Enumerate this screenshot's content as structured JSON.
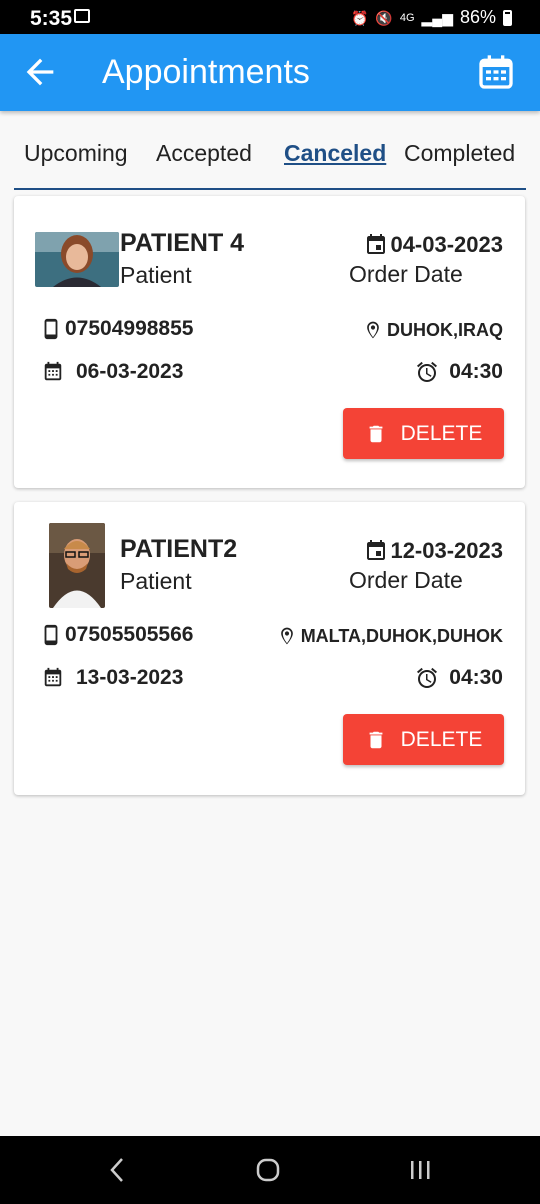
{
  "status_bar": {
    "time": "5:35",
    "signal": "4G",
    "battery": "86%"
  },
  "app_bar": {
    "title": "Appointments"
  },
  "tabs": [
    {
      "label": "Upcoming",
      "active": false
    },
    {
      "label": "Accepted",
      "active": false
    },
    {
      "label": "Canceled",
      "active": true
    },
    {
      "label": "Completed",
      "active": false
    }
  ],
  "appointments": [
    {
      "name": "PATIENT 4",
      "role": "Patient",
      "order_date": "04-03-2023",
      "order_label": "Order Date",
      "phone": "07504998855",
      "location": "DUHOK,IRAQ",
      "date": "06-03-2023",
      "time": "04:30",
      "delete_label": "DELETE"
    },
    {
      "name": "PATIENT2",
      "role": "Patient",
      "order_date": "12-03-2023",
      "order_label": "Order Date",
      "phone": "07505505566",
      "location": "MALTA,DUHOK,DUHOK",
      "date": "13-03-2023",
      "time": "04:30",
      "delete_label": "DELETE"
    }
  ],
  "colors": {
    "primary": "#2196f3",
    "tab_active": "#1f4f86",
    "delete": "#f44336"
  },
  "icons": [
    "back-arrow-icon",
    "calendar-icon",
    "event-icon",
    "phone-icon",
    "location-pin-icon",
    "date-icon",
    "alarm-icon",
    "trash-icon"
  ]
}
